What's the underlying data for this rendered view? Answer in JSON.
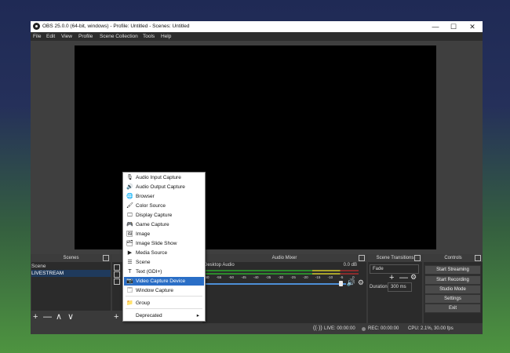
{
  "window": {
    "title": "OBS 25.0.0 (64-bit, windows) - Profile: Untitled - Scenes: Untitled",
    "minimize_glyph": "—",
    "maximize_glyph": "☐",
    "close_glyph": "✕"
  },
  "menu": [
    "File",
    "Edit",
    "View",
    "Profile",
    "Scene Collection",
    "Tools",
    "Help"
  ],
  "scenes": {
    "header": "Scenes",
    "items": [
      "Scene",
      "LIVESTREAM"
    ],
    "selected": "LIVESTREAM",
    "toolbar": [
      "+",
      "—",
      "∧",
      "∨"
    ]
  },
  "sources": {
    "toolbar_add": "+"
  },
  "mixer": {
    "header": "Audio Mixer",
    "channel": "Desktop Audio",
    "level": "0.0 dB",
    "scale": [
      "-60",
      "-55",
      "-50",
      "-45",
      "-40",
      "-35",
      "-30",
      "-25",
      "-20",
      "-15",
      "-10",
      "-5",
      "0"
    ]
  },
  "transitions": {
    "header": "Scene Transitions",
    "transition": "Fade",
    "duration_label": "Duration",
    "duration_value": "300 ms",
    "add": "+",
    "remove": "—"
  },
  "controls": {
    "header": "Controls",
    "buttons": [
      "Start Streaming",
      "Start Recording",
      "Studio Mode",
      "Settings",
      "Exit"
    ]
  },
  "status": {
    "live": "LIVE: 00:00:00",
    "rec": "REC: 00:00:00",
    "cpu": "CPU: 2.1%, 30.00 fps"
  },
  "context_menu": {
    "items": [
      {
        "icon": "microphone-icon",
        "glyph": "🎙",
        "label": "Audio Input Capture"
      },
      {
        "icon": "speaker-icon",
        "glyph": "🔊",
        "label": "Audio Output Capture"
      },
      {
        "icon": "globe-icon",
        "glyph": "🌐",
        "label": "Browser"
      },
      {
        "icon": "brush-icon",
        "glyph": "🖌",
        "label": "Color Source"
      },
      {
        "icon": "monitor-icon",
        "glyph": "🖵",
        "label": "Display Capture"
      },
      {
        "icon": "gamepad-icon",
        "glyph": "🎮",
        "label": "Game Capture"
      },
      {
        "icon": "image-icon",
        "glyph": "🖼",
        "label": "Image"
      },
      {
        "icon": "slideshow-icon",
        "glyph": "🗂",
        "label": "Image Slide Show"
      },
      {
        "icon": "play-icon",
        "glyph": "▶",
        "label": "Media Source"
      },
      {
        "icon": "list-icon",
        "glyph": "☰",
        "label": "Scene"
      },
      {
        "icon": "text-icon",
        "glyph": "T",
        "label": "Text (GDI+)"
      },
      {
        "icon": "camera-icon",
        "glyph": "📷",
        "label": "Video Capture Device"
      },
      {
        "icon": "window-icon",
        "glyph": "🗔",
        "label": "Window Capture"
      },
      {
        "icon": "folder-icon",
        "glyph": "📁",
        "label": "Group"
      },
      {
        "icon": "",
        "glyph": "",
        "label": "Deprecated"
      }
    ],
    "highlighted": "Video Capture Device",
    "submenu_arrow": "▸"
  },
  "colors": {
    "highlight": "#2a6ec6",
    "selected_row": "#1f3a5c"
  }
}
